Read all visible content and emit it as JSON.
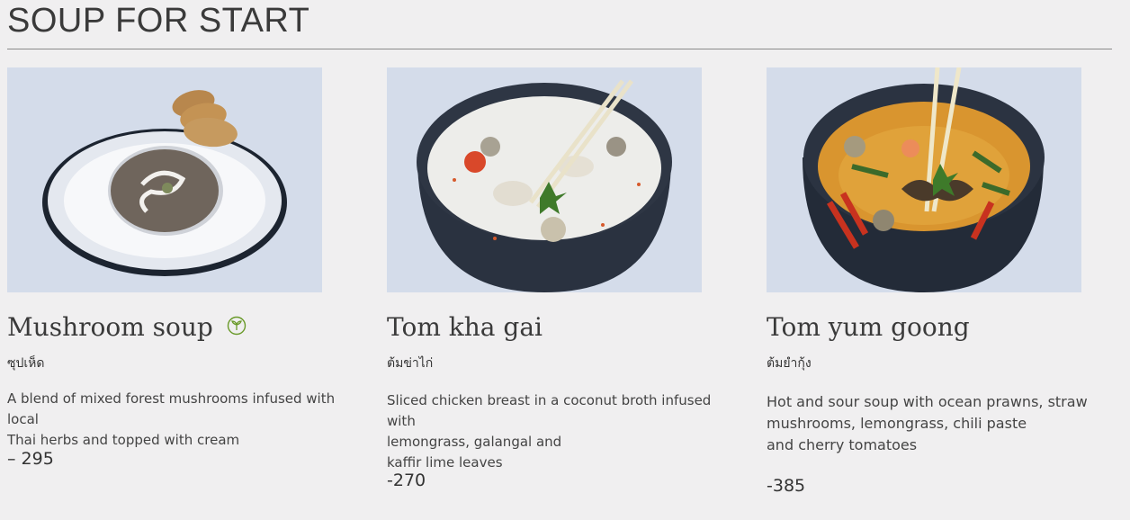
{
  "section": {
    "title": "SOUP FOR START"
  },
  "dishes": [
    {
      "name": "Mushroom soup",
      "vegetarian_icon": "leaf-icon",
      "thai_name": "ซุปเห็ด",
      "description": "A blend of mixed forest mushrooms infused with local\nThai herbs and topped with cream",
      "price": "– 295"
    },
    {
      "name": "Tom kha gai",
      "thai_name": "ต้มข่าไก่",
      "description": "Sliced chicken breast in a coconut broth infused with\nlemongrass, galangal and\nkaffir lime leaves",
      "price": "-270"
    },
    {
      "name": "Tom yum goong",
      "thai_name": "ต้มยำกุ้ง",
      "description": "Hot and sour soup with ocean prawns, straw\nmushrooms, lemongrass, chili paste\nand cherry tomatoes",
      "price": "-385"
    }
  ],
  "colors": {
    "background": "#f0eff0",
    "photo_bg": "#d4dcea",
    "veg_green": "#6a9a2a"
  }
}
